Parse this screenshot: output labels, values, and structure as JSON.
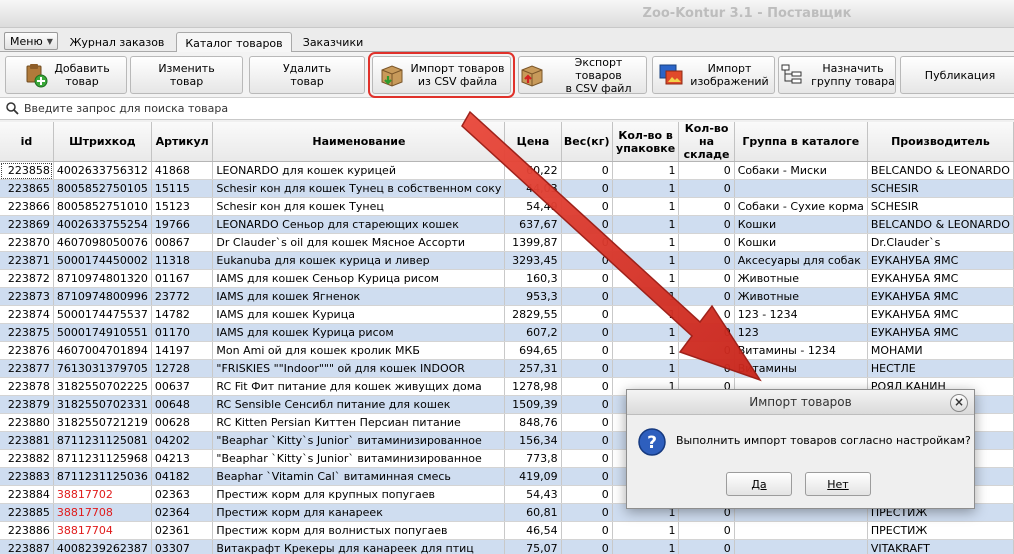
{
  "window": {
    "title": "Zoo-Kontur 3.1 - Поставщик"
  },
  "menu": {
    "label": "Меню"
  },
  "tabs": [
    {
      "label": "Журнал заказов"
    },
    {
      "label": "Каталог товаров"
    },
    {
      "label": "Заказчики"
    }
  ],
  "toolbar": {
    "add_product": "Добавить\nтовар",
    "edit_product": "Изменить\nтовар",
    "delete_product": "Удалить\nтовар",
    "import_csv": "Импорт товаров\nиз CSV файла",
    "export_csv": "Экспорт товаров\nв CSV файл",
    "import_images": "Импорт\nизображений",
    "assign_group": "Назначить\nгруппу товара",
    "publish": "Публикация"
  },
  "search": {
    "placeholder": "Введите запрос для поиска товара"
  },
  "table": {
    "columns": [
      "id",
      "Штрихкод",
      "Артикул",
      "Наименование",
      "Цена",
      "Вес(кг)",
      "Кол-во в упаковке",
      "Кол-во на складе",
      "Группа в каталоге",
      "Производитель"
    ],
    "rows": [
      [
        "223858",
        "4002633756312",
        "41868",
        "LEONARDO для кошек курицей",
        "60,22",
        "0",
        "1",
        "0",
        "Собаки - Миски",
        "BELCANDO & LEONARDO"
      ],
      [
        "223865",
        "8005852750105",
        "15115",
        "Schesir кон для кошек Тунец в собственном соку",
        "44,03",
        "0",
        "1",
        "0",
        "",
        "SCHESIR"
      ],
      [
        "223866",
        "8005852751010",
        "15123",
        "Schesir кон для кошек Тунец",
        "54,49",
        "0",
        "1",
        "0",
        "Собаки - Сухие корма",
        "SCHESIR"
      ],
      [
        "223869",
        "4002633755254",
        "19766",
        "LEONARDO Сеньор для стареющих кошек",
        "637,67",
        "0",
        "1",
        "0",
        "Кошки",
        "BELCANDO & LEONARDO"
      ],
      [
        "223870",
        "4607098050076",
        "00867",
        "Dr Clauder`s oil для кошек Мясное Ассорти",
        "1399,87",
        "0",
        "1",
        "0",
        "Кошки",
        "Dr.Clauder`s"
      ],
      [
        "223871",
        "5000174450002",
        "11318",
        "Eukanuba для кошек курица и ливер",
        "3293,45",
        "0",
        "1",
        "0",
        "Аксесуары для собак",
        "ЕУКАНУБА ЯМС"
      ],
      [
        "223872",
        "8710974801320",
        "01167",
        "IAMS для кошек Сеньор Курица рисом",
        "160,3",
        "0",
        "1",
        "0",
        "Животные",
        "ЕУКАНУБА ЯМС"
      ],
      [
        "223873",
        "8710974800996",
        "23772",
        "IAMS для кошек Ягненок",
        "953,3",
        "0",
        "1",
        "0",
        "Животные",
        "ЕУКАНУБА ЯМС"
      ],
      [
        "223874",
        "5000174475537",
        "14782",
        "IAMS для кошек Курица",
        "2829,55",
        "0",
        "1",
        "0",
        "123 - 1234",
        "ЕУКАНУБА ЯМС"
      ],
      [
        "223875",
        "5000174910551",
        "01170",
        "IAMS для кошек Курица рисом",
        "607,2",
        "0",
        "1",
        "0",
        "123",
        "ЕУКАНУБА ЯМС"
      ],
      [
        "223876",
        "4607004701894",
        "14197",
        "Mon Ami ой для кошек кролик МКБ",
        "694,65",
        "0",
        "1",
        "0",
        "Витамины - 1234",
        "МОНАМИ"
      ],
      [
        "223877",
        "7613031379705",
        "12728",
        "\"FRISKIES \"\"Indoor\"\"\" ой для кошек INDOOR",
        "257,31",
        "0",
        "1",
        "0",
        "Витамины",
        "НЕСТЛЕ"
      ],
      [
        "223878",
        "3182550702225",
        "00637",
        "RC Fit Фит питание для кошек живущих дома",
        "1278,98",
        "0",
        "1",
        "0",
        "",
        "РОЯЛ КАНИН"
      ],
      [
        "223879",
        "3182550702331",
        "00648",
        "RC Sensible Сенсибл питание для кошек",
        "1509,39",
        "0",
        "1",
        "0",
        "",
        "РОЯЛ КАНИН"
      ],
      [
        "223880",
        "3182550721219",
        "00628",
        "RC Kitten Persian Киттен Персиан питание",
        "848,76",
        "0",
        "1",
        "0",
        "",
        "РОЯЛ КАНИН"
      ],
      [
        "223881",
        "8711231125081",
        "04202",
        "\"Beaphar `Kitty`s Junior` витаминизированное",
        "156,34",
        "0",
        "1",
        "0",
        "",
        "БЕАФАР"
      ],
      [
        "223882",
        "8711231125968",
        "04213",
        "\"Beaphar `Kitty`s Junior` витаминизированное",
        "773,8",
        "0",
        "1",
        "0",
        "",
        "БЕАФАР"
      ],
      [
        "223883",
        "8711231125036",
        "04182",
        "Beaphar `Vitamin Cal` витаминная смесь",
        "419,09",
        "0",
        "1",
        "0",
        "",
        "БЕАФАР"
      ],
      [
        "223884",
        "38817702",
        "02363",
        "Престиж корм для крупных попугаев",
        "54,43",
        "0",
        "1",
        "0",
        "",
        "ПРЕСТИЖ"
      ],
      [
        "223885",
        "38817708",
        "02364",
        "Престиж корм для канареек",
        "60,81",
        "0",
        "1",
        "0",
        "",
        "ПРЕСТИЖ"
      ],
      [
        "223886",
        "38817704",
        "02361",
        "Престиж корм для волнистых попугаев",
        "46,54",
        "0",
        "1",
        "0",
        "",
        "ПРЕСТИЖ"
      ],
      [
        "223887",
        "4008239262387",
        "03307",
        "Витакрафт Крекеры для канареек для птиц",
        "75,07",
        "0",
        "1",
        "0",
        "",
        "VITAKRAFT"
      ]
    ]
  },
  "dialog": {
    "title": "Импорт товаров",
    "message": "Выполнить импорт товаров согласно настройкам?",
    "yes": "Да",
    "no": "Нет"
  }
}
